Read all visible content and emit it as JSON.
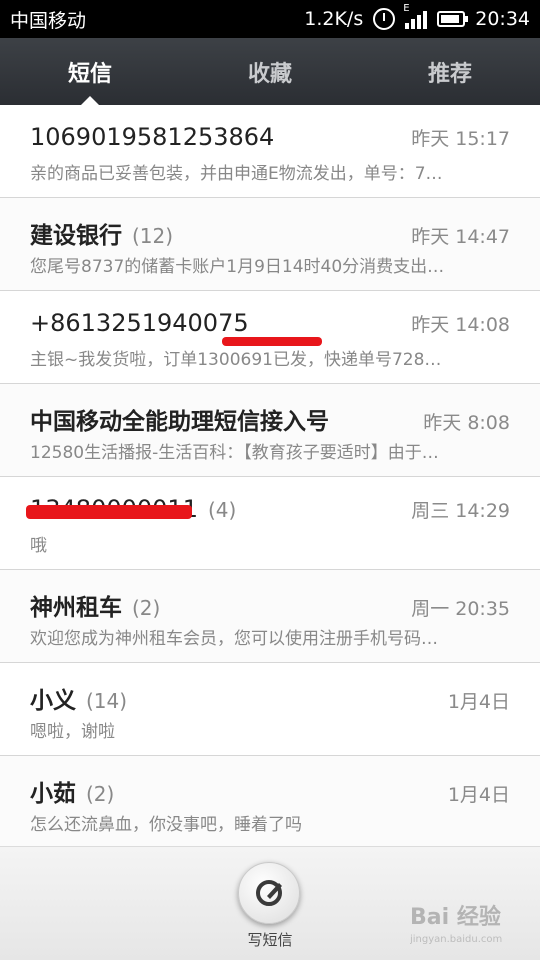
{
  "status_bar": {
    "carrier": "中国移动",
    "speed": "1.2K/s",
    "network": "E",
    "time": "20:34"
  },
  "tabs": [
    {
      "label": "短信",
      "active": true
    },
    {
      "label": "收藏",
      "active": false
    },
    {
      "label": "推荐",
      "active": false
    }
  ],
  "conversations": [
    {
      "name": "1069019581253864",
      "count": "",
      "time": "昨天 15:17",
      "preview": "亲的商品已妥善包装，并由申通E物流发出，单号：7…"
    },
    {
      "name": "建设银行",
      "count": "(12)",
      "time": "昨天 14:47",
      "preview": "您尾号8737的储蓄卡账户1月9日14时40分消费支出…"
    },
    {
      "name": "+8613251940075",
      "count": "",
      "time": "昨天 14:08",
      "preview": "主银~我发货啦，订单1300691已发，快递单号728…"
    },
    {
      "name": "中国移动全能助理短信接入号",
      "count": "",
      "time": "昨天 8:08",
      "preview": "12580生活播报-生活百科：【教育孩子要适时】由于…"
    },
    {
      "name": "13480000011",
      "count": "(4)",
      "time": "周三 14:29",
      "preview": "哦"
    },
    {
      "name": "神州租车",
      "count": "(2)",
      "time": "周一 20:35",
      "preview": "欢迎您成为神州租车会员，您可以使用注册手机号码…"
    },
    {
      "name": "小义",
      "count": "(14)",
      "time": "1月4日",
      "preview": "嗯啦，谢啦"
    },
    {
      "name": "小茹",
      "count": "(2)",
      "time": "1月4日",
      "preview": "怎么还流鼻血，你没事吧，睡着了吗"
    }
  ],
  "compose": {
    "label": "写短信"
  },
  "watermark": {
    "text": "Bai 经验",
    "sub": "jingyan.baidu.com"
  },
  "colors": {
    "tab_bg": "#2b2e33",
    "redaction": "#e8161b"
  }
}
